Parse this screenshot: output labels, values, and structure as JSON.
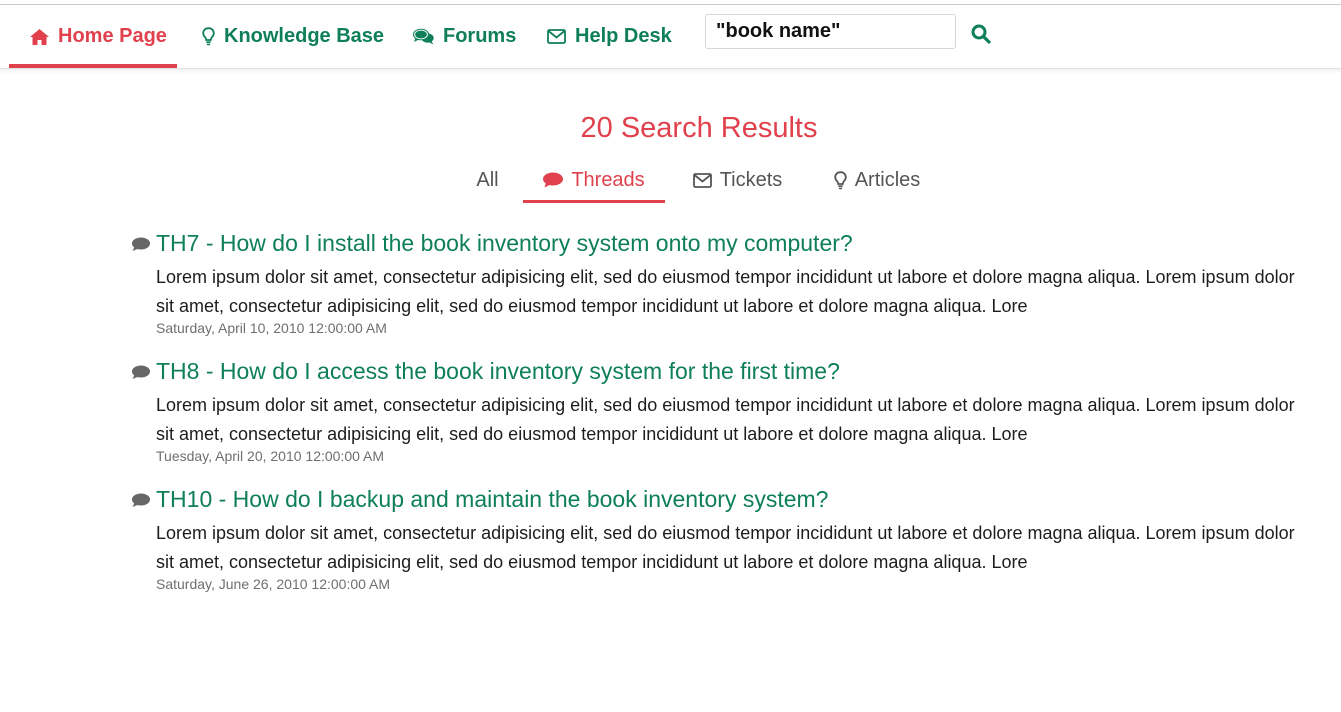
{
  "nav": {
    "items": [
      {
        "label": "Home Page",
        "icon": "home-icon",
        "active": true
      },
      {
        "label": "Knowledge Base",
        "icon": "lightbulb-icon",
        "active": false
      },
      {
        "label": "Forums",
        "icon": "comments-icon",
        "active": false
      },
      {
        "label": "Help Desk",
        "icon": "envelope-icon",
        "active": false
      }
    ],
    "search_value": "\"book name\"",
    "search_icon": "search-icon"
  },
  "results": {
    "heading": "20 Search Results",
    "tabs": [
      {
        "label": "All",
        "icon": "",
        "active": false
      },
      {
        "label": "Threads",
        "icon": "comment-icon",
        "active": true
      },
      {
        "label": "Tickets",
        "icon": "envelope-icon",
        "active": false
      },
      {
        "label": "Articles",
        "icon": "lightbulb-icon",
        "active": false
      }
    ],
    "items": [
      {
        "title": "TH7 - How do I install the book inventory system onto my computer?",
        "body": "Lorem ipsum dolor sit amet, consectetur adipisicing elit, sed do eiusmod tempor incididunt ut labore et dolore magna aliqua. Lorem ipsum dolor sit amet, consectetur adipisicing elit, sed do eiusmod tempor incididunt ut labore et dolore magna aliqua. Lore",
        "date": "Saturday, April 10, 2010 12:00:00 AM"
      },
      {
        "title": "TH8 - How do I access the book inventory system for the first time?",
        "body": "Lorem ipsum dolor sit amet, consectetur adipisicing elit, sed do eiusmod tempor incididunt ut labore et dolore magna aliqua. Lorem ipsum dolor sit amet, consectetur adipisicing elit, sed do eiusmod tempor incididunt ut labore et dolore magna aliqua. Lore",
        "date": "Tuesday, April 20, 2010 12:00:00 AM"
      },
      {
        "title": "TH10 - How do I backup and maintain the book inventory system?",
        "body": "Lorem ipsum dolor sit amet, consectetur adipisicing elit, sed do eiusmod tempor incididunt ut labore et dolore magna aliqua. Lorem ipsum dolor sit amet, consectetur adipisicing elit, sed do eiusmod tempor incididunt ut labore et dolore magna aliqua. Lore",
        "date": "Saturday, June 26, 2010 12:00:00 AM"
      }
    ]
  },
  "colors": {
    "accent": "#e0414c",
    "brand_green": "#0e7f58",
    "tab_text": "#555555",
    "date_text": "#6f6f6f"
  }
}
